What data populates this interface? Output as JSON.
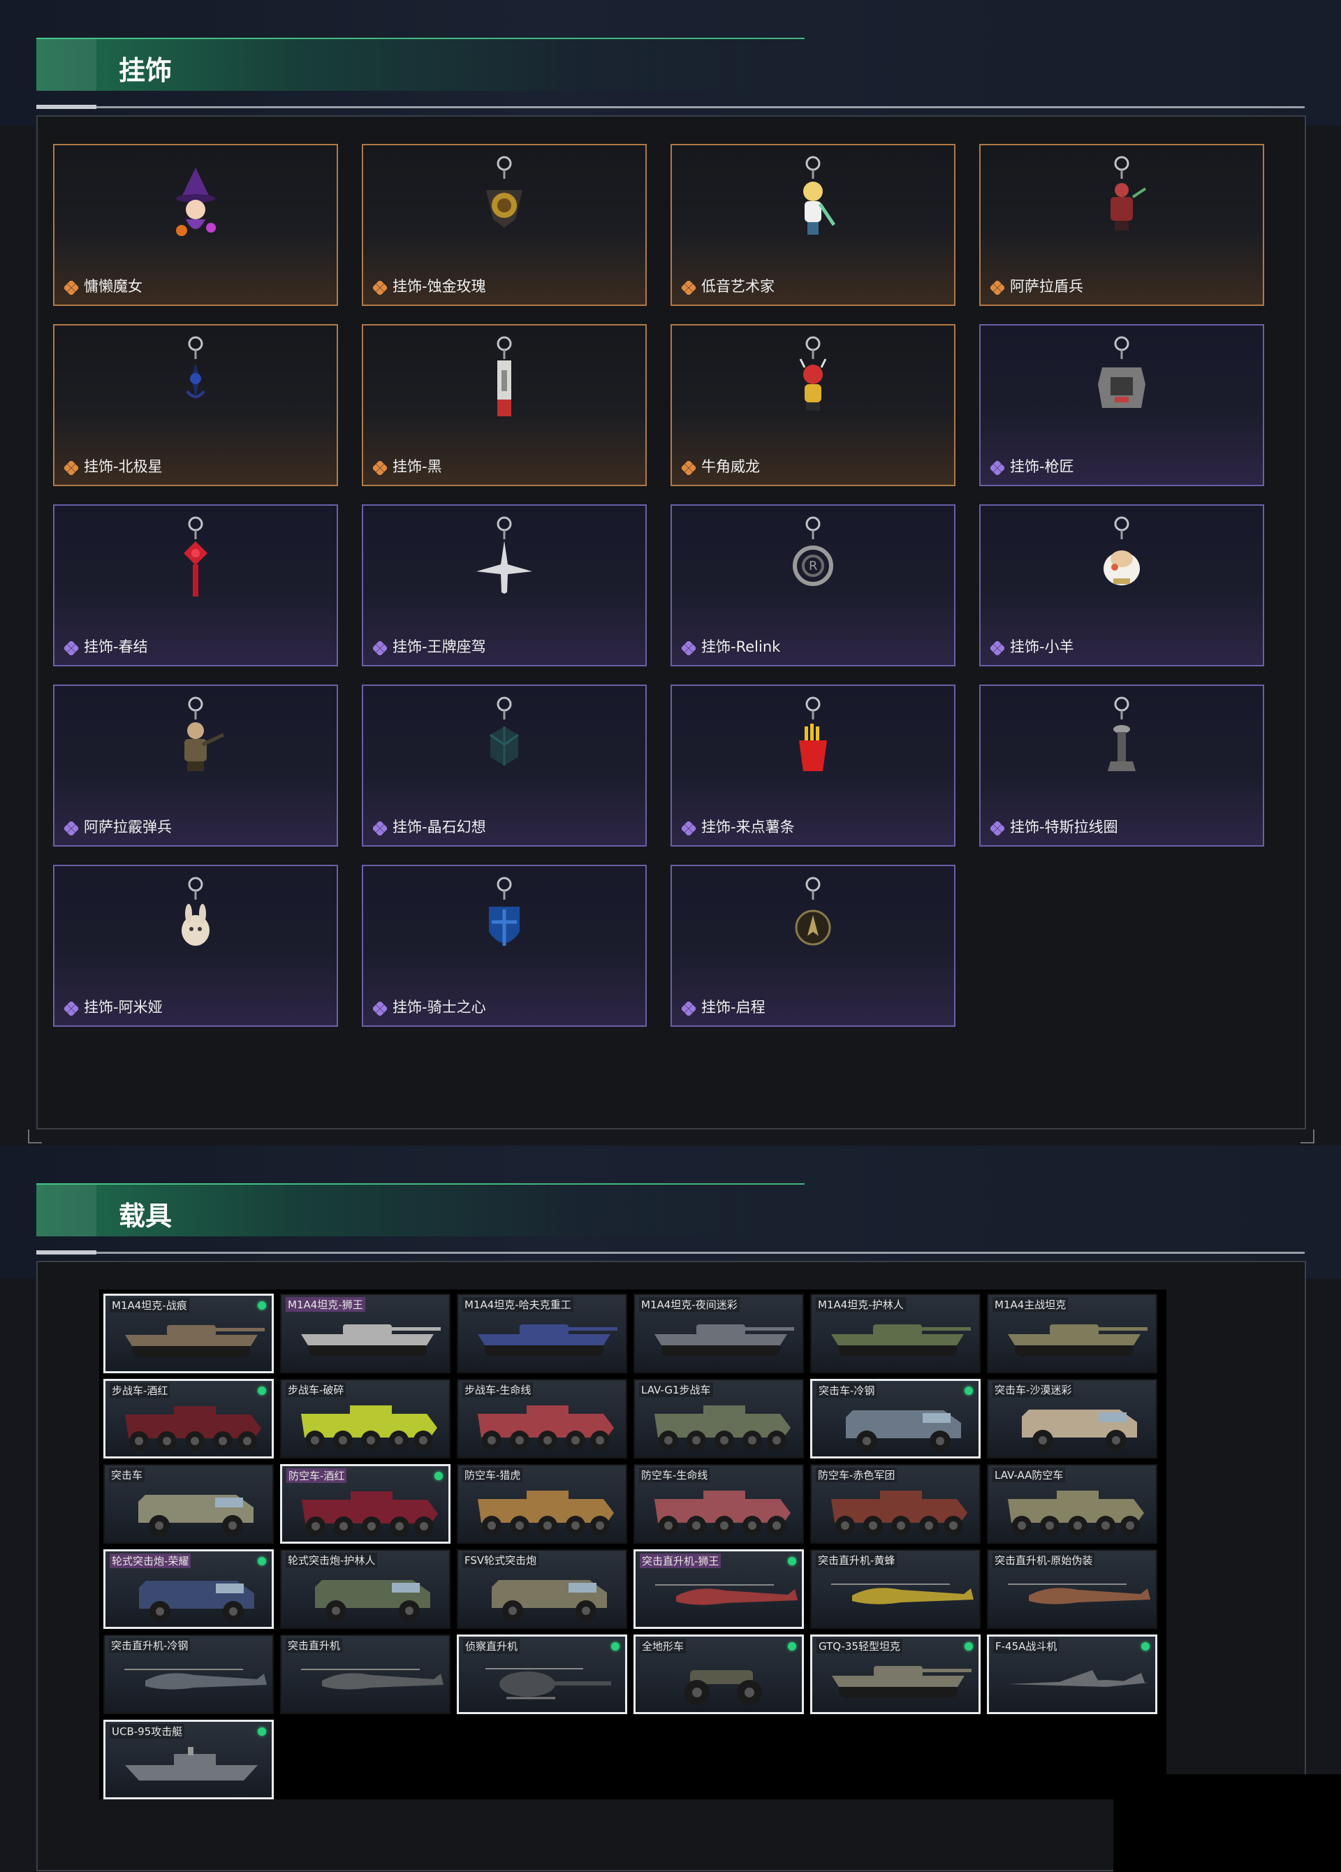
{
  "charms": {
    "title": "挂饰",
    "items": [
      {
        "label": "慵懒魔女",
        "rarity": "orange",
        "icon": "witch-charm-icon"
      },
      {
        "label": "挂饰-蚀金玫瑰",
        "rarity": "orange",
        "icon": "rose-medallion-charm-icon"
      },
      {
        "label": "低音艺术家",
        "rarity": "orange",
        "icon": "bassist-figure-charm-icon"
      },
      {
        "label": "阿萨拉盾兵",
        "rarity": "orange",
        "icon": "shield-soldier-charm-icon"
      },
      {
        "label": "挂饰-北极星",
        "rarity": "orange",
        "icon": "star-charm-icon"
      },
      {
        "label": "挂饰-黑",
        "rarity": "orange",
        "icon": "blade-charm-icon"
      },
      {
        "label": "牛角威龙",
        "rarity": "orange",
        "icon": "horned-dragon-charm-icon"
      },
      {
        "label": "挂饰-枪匠",
        "rarity": "purple",
        "icon": "gunsmith-tag-charm-icon"
      },
      {
        "label": "挂饰-春结",
        "rarity": "purple",
        "icon": "chinese-knot-charm-icon"
      },
      {
        "label": "挂饰-王牌座驾",
        "rarity": "purple",
        "icon": "jet-plane-charm-icon"
      },
      {
        "label": "挂饰-Relink",
        "rarity": "purple",
        "icon": "relink-ring-charm-icon"
      },
      {
        "label": "挂饰-小羊",
        "rarity": "purple",
        "icon": "lamb-charm-icon"
      },
      {
        "label": "阿萨拉霰弹兵",
        "rarity": "purple",
        "icon": "shotgunner-charm-icon"
      },
      {
        "label": "挂饰-晶石幻想",
        "rarity": "purple",
        "icon": "crystal-cube-charm-icon"
      },
      {
        "label": "挂饰-来点薯条",
        "rarity": "purple",
        "icon": "fries-charm-icon"
      },
      {
        "label": "挂饰-特斯拉线圈",
        "rarity": "purple",
        "icon": "tesla-coil-charm-icon"
      },
      {
        "label": "挂饰-阿米娅",
        "rarity": "purple",
        "icon": "bunny-charm-icon"
      },
      {
        "label": "挂饰-骑士之心",
        "rarity": "purple",
        "icon": "knight-shield-charm-icon"
      },
      {
        "label": "挂饰-启程",
        "rarity": "purple",
        "icon": "compass-medal-charm-icon"
      }
    ]
  },
  "vehicles": {
    "title": "载具",
    "items": [
      {
        "label": "M1A4坦克-战痕",
        "selected": true,
        "dot": true,
        "type": "tank",
        "tint": "#7a6a55"
      },
      {
        "label": "M1A4坦克-狮王",
        "selected": false,
        "dot": false,
        "type": "tank",
        "tint": "#b0b0b0",
        "hl": true
      },
      {
        "label": "M1A4坦克-哈夫克重工",
        "selected": false,
        "dot": false,
        "type": "tank",
        "tint": "#3c4a8a"
      },
      {
        "label": "M1A4坦克-夜间迷彩",
        "selected": false,
        "dot": false,
        "type": "tank",
        "tint": "#6c7078"
      },
      {
        "label": "M1A4坦克-护林人",
        "selected": false,
        "dot": false,
        "type": "tank",
        "tint": "#5f6e4a"
      },
      {
        "label": "M1A4主战坦克",
        "selected": false,
        "dot": false,
        "type": "tank",
        "tint": "#7e7c5a"
      },
      {
        "label": "步战车-酒红",
        "selected": true,
        "dot": true,
        "type": "apc",
        "tint": "#6a2028"
      },
      {
        "label": "步战车-破碎",
        "selected": false,
        "dot": false,
        "type": "apc",
        "tint": "#b8c830"
      },
      {
        "label": "步战车-生命线",
        "selected": false,
        "dot": false,
        "type": "apc",
        "tint": "#a24048"
      },
      {
        "label": "LAV-G1步战车",
        "selected": false,
        "dot": false,
        "type": "apc",
        "tint": "#667058"
      },
      {
        "label": "突击车-冷钢",
        "selected": true,
        "dot": true,
        "type": "truck",
        "tint": "#6a7888"
      },
      {
        "label": "突击车-沙漠迷彩",
        "selected": false,
        "dot": false,
        "type": "truck",
        "tint": "#b8a890"
      },
      {
        "label": "突击车",
        "selected": false,
        "dot": false,
        "type": "truck",
        "tint": "#8a8a72"
      },
      {
        "label": "防空车-酒红",
        "selected": true,
        "dot": true,
        "type": "apc",
        "tint": "#7a2030",
        "hl": true
      },
      {
        "label": "防空车-猎虎",
        "selected": false,
        "dot": false,
        "type": "apc",
        "tint": "#a07840"
      },
      {
        "label": "防空车-生命线",
        "selected": false,
        "dot": false,
        "type": "apc",
        "tint": "#9a5056"
      },
      {
        "label": "防空车-赤色军团",
        "selected": false,
        "dot": false,
        "type": "apc",
        "tint": "#7a3a30"
      },
      {
        "label": "LAV-AA防空车",
        "selected": false,
        "dot": false,
        "type": "apc",
        "tint": "#868264"
      },
      {
        "label": "轮式突击炮-荣耀",
        "selected": true,
        "dot": true,
        "type": "truck",
        "tint": "#3a4a70",
        "hl": true
      },
      {
        "label": "轮式突击炮-护林人",
        "selected": false,
        "dot": false,
        "type": "truck",
        "tint": "#5a6850"
      },
      {
        "label": "FSV轮式突击炮",
        "selected": false,
        "dot": false,
        "type": "truck",
        "tint": "#7a7660"
      },
      {
        "label": "突击直升机-狮王",
        "selected": true,
        "dot": true,
        "type": "heli",
        "tint": "#9a3a3a",
        "hl": true
      },
      {
        "label": "突击直升机-黄蜂",
        "selected": false,
        "dot": false,
        "type": "heli",
        "tint": "#b09a30"
      },
      {
        "label": "突击直升机-原始伪装",
        "selected": false,
        "dot": false,
        "type": "heli",
        "tint": "#8a5a40"
      },
      {
        "label": "突击直升机-冷钢",
        "selected": false,
        "dot": false,
        "type": "heli",
        "tint": "#60666e"
      },
      {
        "label": "突击直升机",
        "selected": false,
        "dot": false,
        "type": "heli",
        "tint": "#5a5e60"
      },
      {
        "label": "侦察直升机",
        "selected": true,
        "dot": true,
        "type": "scout",
        "tint": "#4a4e52"
      },
      {
        "label": "全地形车",
        "selected": true,
        "dot": true,
        "type": "atv",
        "tint": "#5a5a4a"
      },
      {
        "label": "GTQ-35轻型坦克",
        "selected": true,
        "dot": true,
        "type": "tank",
        "tint": "#7a7868"
      },
      {
        "label": "F-45A战斗机",
        "selected": true,
        "dot": true,
        "type": "jet",
        "tint": "#6a6e72"
      },
      {
        "label": "UCB-95攻击艇",
        "selected": true,
        "dot": true,
        "type": "boat",
        "tint": "#70767c"
      }
    ]
  },
  "colors": {
    "orange_border": "#b07a48",
    "purple_border": "#6a5fa8",
    "accent_green": "#28d07a"
  }
}
